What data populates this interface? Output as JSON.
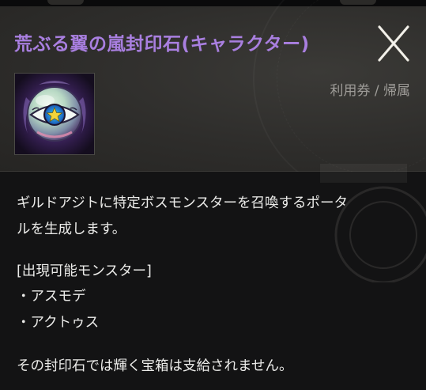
{
  "item": {
    "name": "荒ぶる翼の嵐封印石(キャラクター)",
    "type_label": "利用券 / 帰属",
    "icon": "storm-seal-stone-icon"
  },
  "description": {
    "line1": "ギルドアジトに特定ボスモンスターを召喚するポータ",
    "line2": "ルを生成します。",
    "monsters_header": "[出現可能モンスター]",
    "monsters": [
      "・アスモデ",
      "・アクトゥス"
    ],
    "note": "その封印石では輝く宝箱は支給されません。"
  },
  "colors": {
    "title": "#a97fe0",
    "header_bg": "#2e2d2b",
    "body_bg": "#131314",
    "body_text": "#ececea",
    "type_text": "#9e9c98"
  }
}
